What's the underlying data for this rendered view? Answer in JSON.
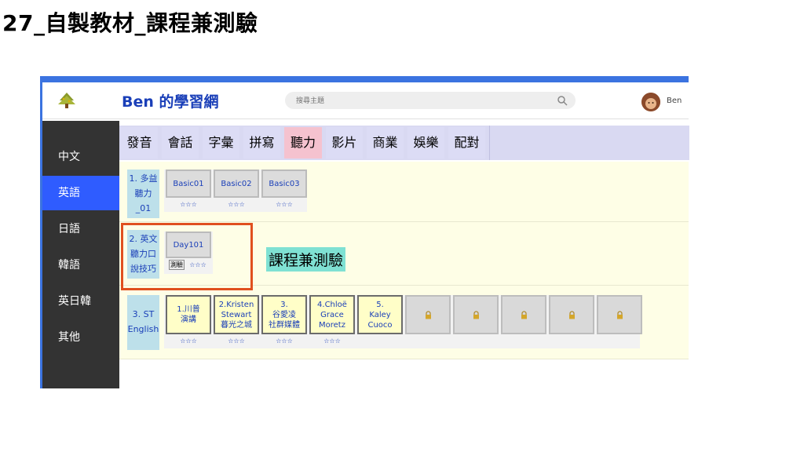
{
  "slide": {
    "title": "27_自製教材_課程兼測驗"
  },
  "header": {
    "site_title": "Ben 的學習網",
    "search_placeholder": "搜尋主題",
    "username": "Ben"
  },
  "sidebar": {
    "items": [
      {
        "label": "中文"
      },
      {
        "label": "英語"
      },
      {
        "label": "日語"
      },
      {
        "label": "韓語"
      },
      {
        "label": "英日韓"
      },
      {
        "label": "其他"
      }
    ],
    "active": "英語"
  },
  "tabs": [
    {
      "label": "發音"
    },
    {
      "label": "會話"
    },
    {
      "label": "字彙"
    },
    {
      "label": "拼寫"
    },
    {
      "label": "聽力"
    },
    {
      "label": "影片"
    },
    {
      "label": "商業"
    },
    {
      "label": "娛樂"
    },
    {
      "label": "配對"
    }
  ],
  "active_tab": "聽力",
  "rows": [
    {
      "label": "1. 多益聽力_01",
      "label_lines": [
        "1. 多益",
        "聽力",
        "_01"
      ],
      "tiles": [
        {
          "label": "Basic01",
          "stars": "☆☆☆"
        },
        {
          "label": "Basic02",
          "stars": "☆☆☆"
        },
        {
          "label": "Basic03",
          "stars": "☆☆☆"
        }
      ]
    },
    {
      "label": "2. 英文聽力口說技巧",
      "label_lines": [
        "2. 英文",
        "聽力口",
        "說技巧"
      ],
      "tiles": [
        {
          "label": "Day101",
          "quiz_button": "測驗",
          "stars": "☆☆☆"
        }
      ]
    },
    {
      "label": "3. ST English",
      "label_lines": [
        "3. ST",
        "English"
      ],
      "tiles": [
        {
          "lines": [
            "1.川普",
            "演講"
          ],
          "stars": "☆☆☆"
        },
        {
          "lines": [
            "2.Kristen",
            "Stewart",
            "暮光之城"
          ],
          "stars": "☆☆☆"
        },
        {
          "lines": [
            "3.",
            "谷愛凌",
            "社群媒體"
          ],
          "stars": "☆☆☆"
        },
        {
          "lines": [
            "4.Chloë",
            "Grace",
            "Moretz"
          ],
          "stars": "☆☆☆"
        },
        {
          "lines": [
            "5.",
            "Kaley",
            "Cuoco"
          ],
          "stars": ""
        }
      ],
      "locked_tiles": 5
    }
  ],
  "annotation": {
    "label": "課程兼測驗"
  },
  "colors": {
    "accent_blue": "#3b73e0",
    "sidebar_bg": "#333333",
    "sidebar_active": "#2f5cff",
    "tab_bg": "#dcdcf5",
    "tab_active": "#f5c2cf",
    "row_bg": "#fefee6",
    "row_label_bg": "#bde0ea",
    "highlight_border": "#e0501f",
    "annotation_bg": "#7fe1d3",
    "link_text": "#1a3fb8"
  }
}
